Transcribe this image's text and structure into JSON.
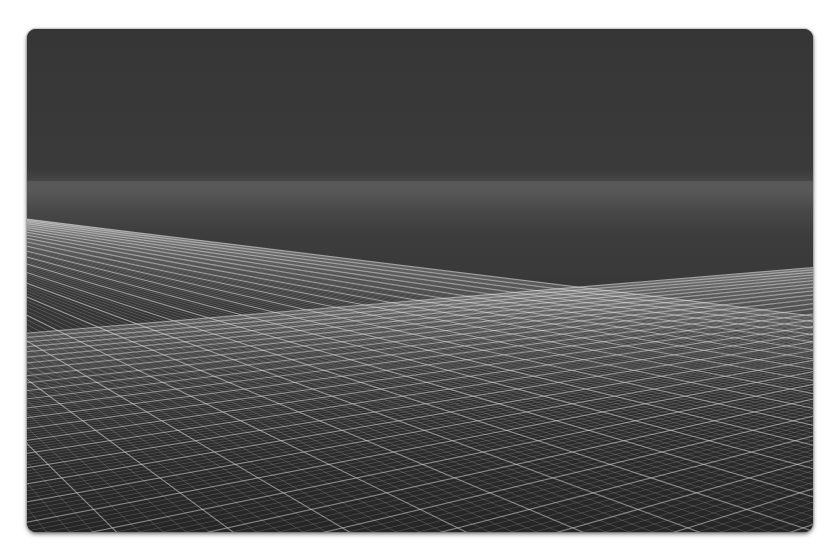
{
  "viewport": {
    "background_color": "#3a3a3a",
    "ground_color": "#2e2e2e",
    "grid_line_color": "#d8d8d8",
    "major_grid_line_color": "#ffffff",
    "horizon_haze_color": "#5a5a5a",
    "grid_visible": true,
    "view": "perspective"
  }
}
